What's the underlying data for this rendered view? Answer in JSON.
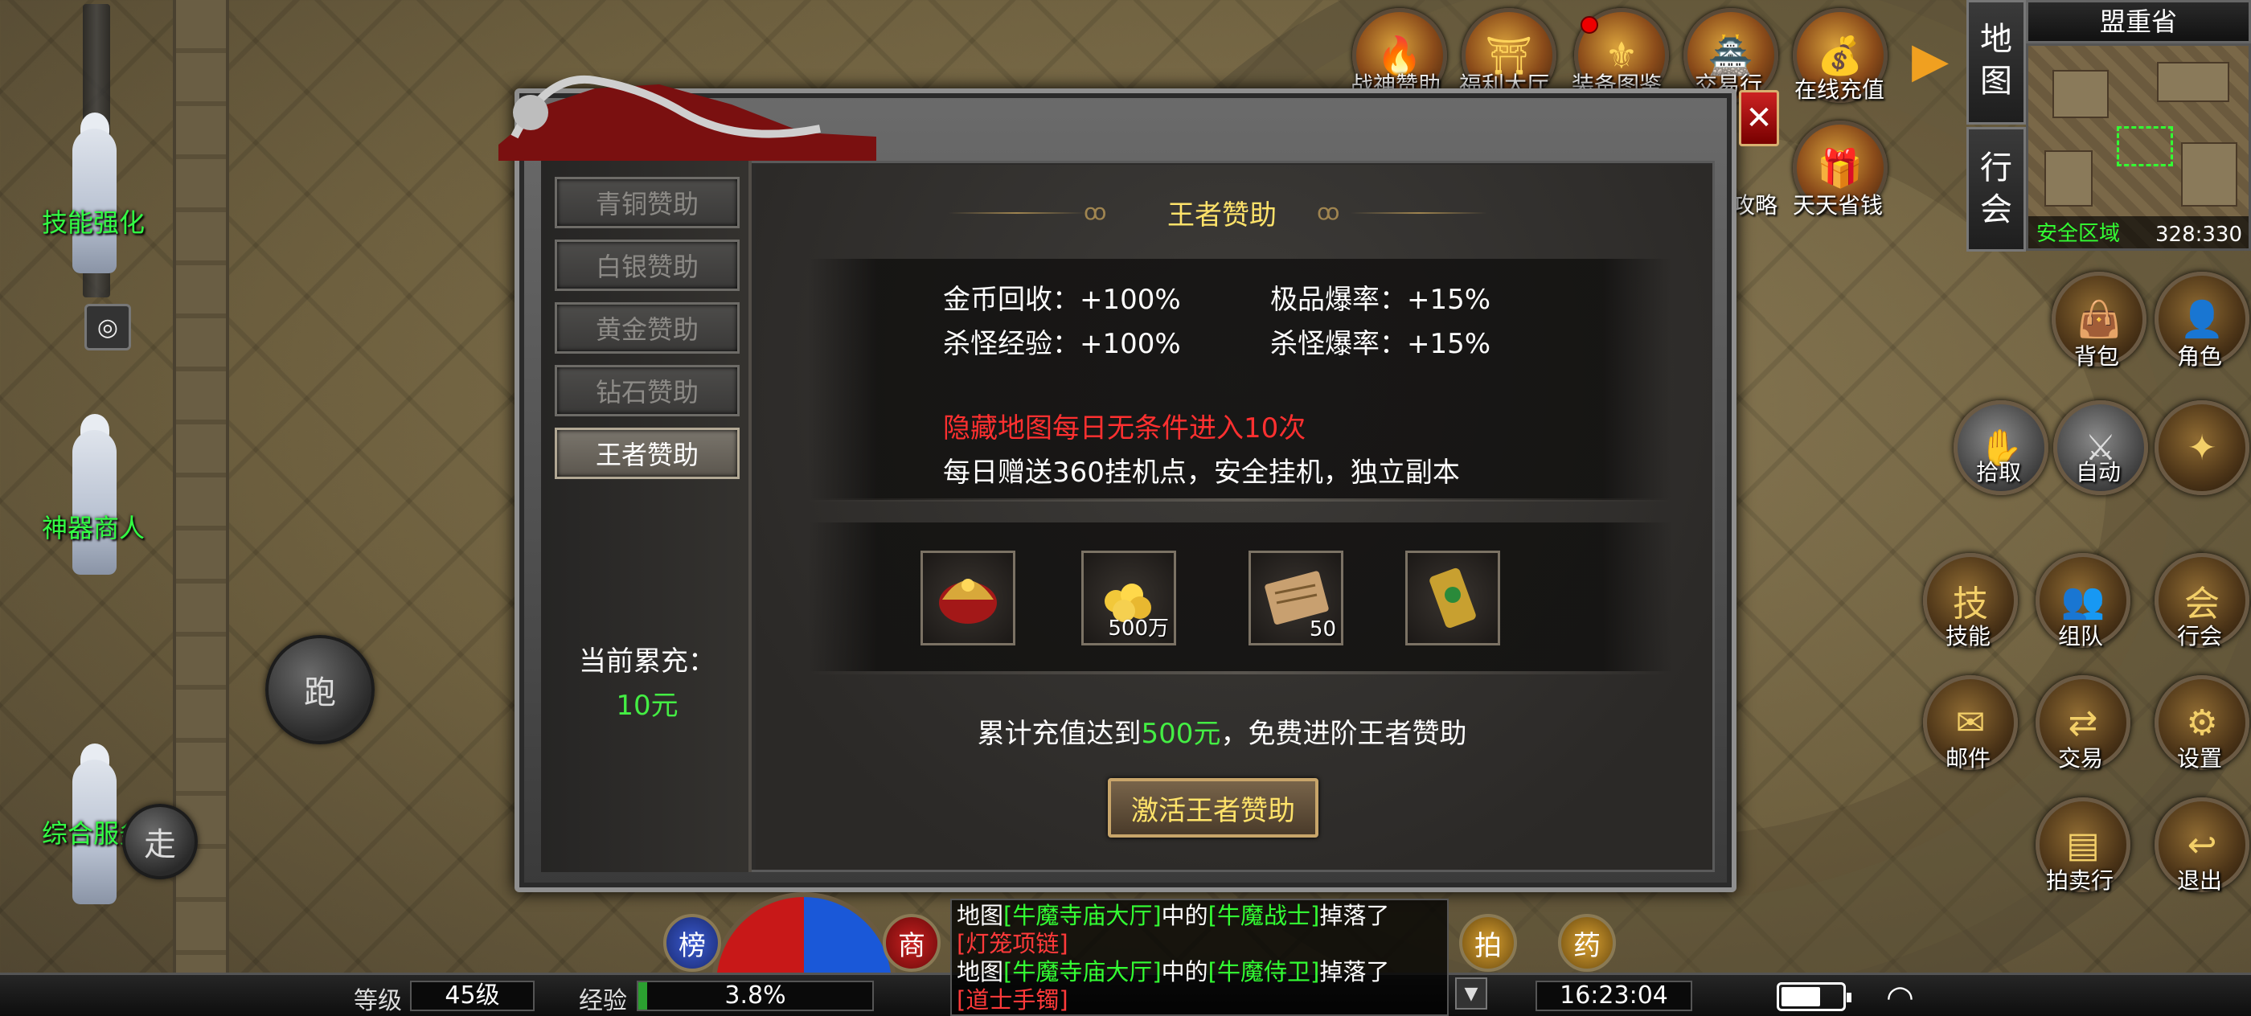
{
  "left_npcs": [
    {
      "name": "技能强化"
    },
    {
      "name": "神器商人"
    },
    {
      "name": "综合服务"
    }
  ],
  "controls": {
    "run_label": "跑",
    "walk_label": "走"
  },
  "top_icons": [
    {
      "label": "战神赞助",
      "icon": "fire-icon"
    },
    {
      "label": "福利大厅",
      "icon": "hall-icon"
    },
    {
      "label": "装备图鉴",
      "icon": "armor-icon"
    },
    {
      "label": "交易行",
      "icon": "trade-icon"
    },
    {
      "label": "在线充值",
      "icon": "gold-icon"
    },
    {
      "label": "攻略",
      "icon": "guide-icon"
    },
    {
      "label": "天天省钱",
      "icon": "gift-icon"
    }
  ],
  "right_nav": {
    "map_label": "地图",
    "guild_label": "行会"
  },
  "minimap": {
    "region": "盟重省",
    "safe_zone": "安全区域",
    "coords": "328:330"
  },
  "right_buttons": [
    {
      "label": "背包",
      "icon": "bag-icon"
    },
    {
      "label": "角色",
      "icon": "character-icon"
    },
    {
      "label": "拾取",
      "icon": "pickup-icon"
    },
    {
      "label": "自动",
      "icon": "auto-icon"
    },
    {
      "label": "",
      "icon": "compass-icon"
    },
    {
      "label": "技能",
      "icon": "skill-icon"
    },
    {
      "label": "组队",
      "icon": "team-icon"
    },
    {
      "label": "行会",
      "icon": "guild-icon"
    },
    {
      "label": "邮件",
      "icon": "mail-icon"
    },
    {
      "label": "交易",
      "icon": "trade-icon"
    },
    {
      "label": "设置",
      "icon": "settings-icon"
    },
    {
      "label": "拍卖行",
      "icon": "auction-icon"
    },
    {
      "label": "退出",
      "icon": "exit-icon"
    }
  ],
  "dialog": {
    "tabs": [
      "青铜赞助",
      "白银赞助",
      "黄金赞助",
      "钻石赞助",
      "王者赞助"
    ],
    "active_tab": "王者赞助",
    "title": "王者赞助",
    "benefits": {
      "gold_recycle": "金币回收：+100%",
      "rare_drop": "极品爆率：+15%",
      "kill_exp": "杀怪经验：+100%",
      "kill_drop": "杀怪爆率：+15%"
    },
    "special_red": "隐藏地图每日无条件进入10次",
    "special_white": "每日赠送360挂机点，安全挂机，独立副本",
    "rewards": [
      {
        "icon": "helmet-icon",
        "qty": ""
      },
      {
        "icon": "gold-coins-icon",
        "qty": "500万"
      },
      {
        "icon": "scroll-icon",
        "qty": "50"
      },
      {
        "icon": "token-icon",
        "qty": ""
      }
    ],
    "cumulative_label": "当前累充：",
    "cumulative_value": "10元",
    "progress_prefix": "累计充值达到",
    "progress_amount": "500元",
    "progress_suffix": "，免费进阶王者赞助",
    "activate_label": "激活王者赞助",
    "close_label": "✕"
  },
  "bottom": {
    "level_label": "等级",
    "level_value": "45级",
    "exp_label": "经验",
    "exp_value": "3.8%",
    "exp_fraction": 0.038,
    "rank_label": "榜",
    "shop_label": "商",
    "auction_label": "拍",
    "potion_label": "药",
    "time": "16:23:04"
  },
  "chat": {
    "line1_prefix": "地图",
    "line1_map": "[牛魔寺庙大厅]",
    "line1_mid": "中的",
    "line1_monster": "[牛魔战士]",
    "line1_suffix": "掉落了",
    "line1_item": "[灯笼项链]",
    "line2_prefix": "地图",
    "line2_map": "[牛魔寺庙大厅]",
    "line2_mid": "中的",
    "line2_monster": "[牛魔侍卫]",
    "line2_suffix": "掉落了",
    "line2_item": "[道士手镯]"
  },
  "colors": {
    "gold_text": "#ffe36a",
    "green_text": "#44ee44",
    "red_text": "#ff3030",
    "npc_green": "#33ff44"
  }
}
